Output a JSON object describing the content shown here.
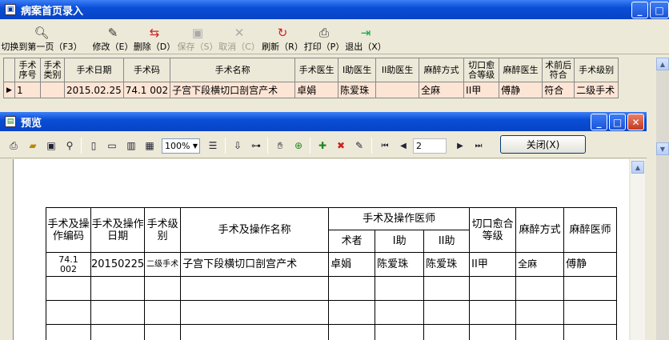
{
  "main_window": {
    "title": "病案首页录入"
  },
  "toolbar": {
    "first_page": "切换到第一页（F3）",
    "edit": "修改（E）",
    "delete": "删除（D）",
    "save": "保存（S）",
    "cancel": "取消（C）",
    "refresh": "刷新（R）",
    "print": "打印（P）",
    "exit": "退出（X）"
  },
  "grid": {
    "headers": [
      "手术序号",
      "手术类别",
      "手术日期",
      "手术码",
      "手术名称",
      "手术医生",
      "I助医生",
      "II助医生",
      "麻醉方式",
      "切口愈合等级",
      "麻醉医生",
      "术前后符合",
      "手术级别"
    ],
    "row": [
      "1",
      "",
      "2015.02.25",
      "74.1 002",
      "子宫下段横切口剖宫产术",
      "卓娟",
      "陈爱珠",
      "",
      "全麻",
      "II甲",
      "傅静",
      "符合",
      "二级手术"
    ]
  },
  "preview": {
    "title": "预览",
    "zoom": "100%",
    "page": "2",
    "close": "关闭(X)",
    "table": {
      "h_code": "手术及操作编码",
      "h_date": "手术及操作日期",
      "h_level": "手术级别",
      "h_name": "手术及操作名称",
      "h_doctor": "手术及操作医师",
      "h_surgeon": "术者",
      "h_a1": "I助",
      "h_a2": "II助",
      "h_wound": "切口愈合等级",
      "h_anes": "麻醉方式",
      "h_anesdoc": "麻醉医师",
      "row": {
        "code": "74.1\n002",
        "date": "20150225",
        "level": "二级手术",
        "name": "子宫下段横切口剖宫产术",
        "surgeon": "卓娟",
        "a1": "陈爱珠",
        "a2": "陈爱珠",
        "wound": "II甲",
        "anes": "全麻",
        "anesdoc": "傅静"
      }
    }
  }
}
